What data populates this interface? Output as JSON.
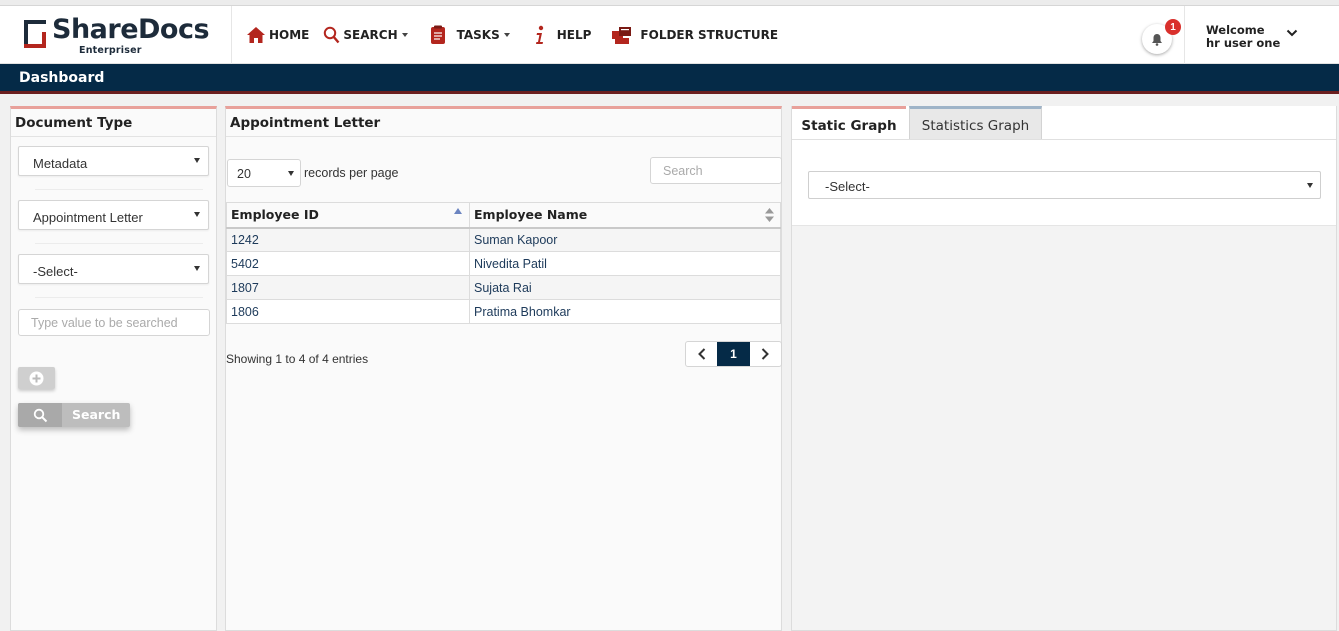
{
  "brand": {
    "name": "ShareDocs",
    "sub": "Enterpriser"
  },
  "nav": {
    "home": "HOME",
    "search": "SEARCH",
    "tasks": "TASKS",
    "help": "HELP",
    "folder": "FOLDER STRUCTURE"
  },
  "notifications": {
    "count": "1"
  },
  "user": {
    "welcome": "Welcome",
    "name": "hr user one"
  },
  "dashboard": {
    "title": "Dashboard"
  },
  "doc_type": {
    "title": "Document Type",
    "select1": "Metadata",
    "select2": "Appointment Letter",
    "select3": "-Select-",
    "input_placeholder": "Type value to be searched",
    "search_label": "Search"
  },
  "table": {
    "title": "Appointment Letter",
    "records_per_page_value": "20",
    "records_per_page_label": "records per page",
    "search_placeholder": "Search",
    "columns": [
      "Employee ID",
      "Employee Name"
    ],
    "rows": [
      [
        "1242",
        "Suman Kapoor"
      ],
      [
        "5402",
        "Nivedita Patil"
      ],
      [
        "1807",
        "Sujata Rai"
      ],
      [
        "1806",
        "Pratima Bhomkar"
      ]
    ],
    "showing": "Showing 1 to 4 of 4 entries",
    "current_page": "1"
  },
  "graph": {
    "tab_static": "Static Graph",
    "tab_stats": "Statistics Graph",
    "select": "-Select-"
  },
  "colors": {
    "navy": "#052a47",
    "brand_red": "#b3261e",
    "accent_pink": "#e8a09a"
  }
}
